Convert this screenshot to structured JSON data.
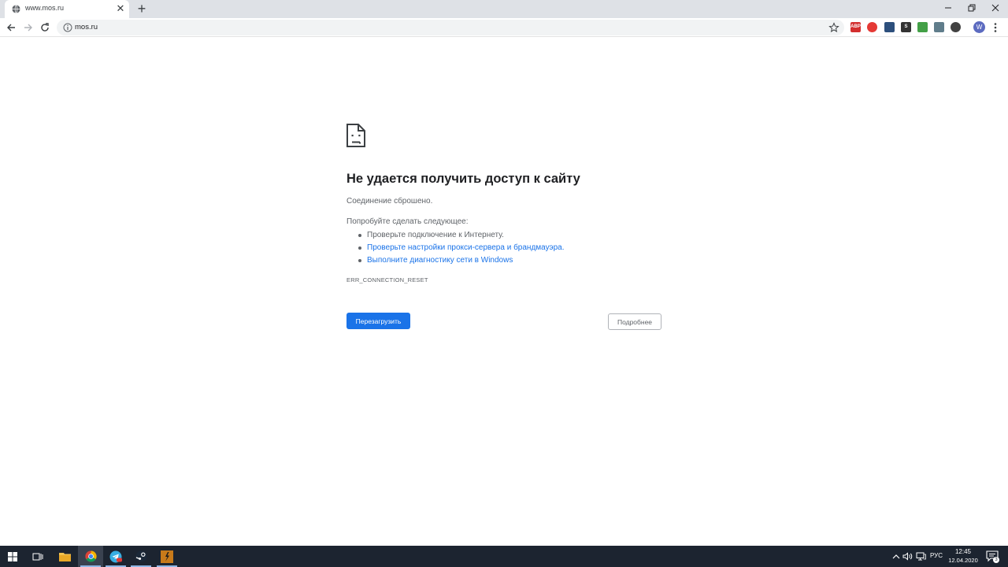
{
  "tab": {
    "title": "www.mos.ru",
    "close_glyph": "✕",
    "favicon": "globe-icon"
  },
  "new_tab_glyph": "+",
  "window_controls": [
    "minimize-icon",
    "restore-icon",
    "close-icon"
  ],
  "toolbar": {
    "url": "mos.ru",
    "extensions": [
      {
        "name": "abp-icon",
        "label": "ABP",
        "color": "#d32f2f"
      },
      {
        "name": "opera-red-icon",
        "label": "",
        "color": "#e53935"
      },
      {
        "name": "extension-mail-icon",
        "label": "",
        "color": "#2d4f7c"
      },
      {
        "name": "extension-s-icon",
        "label": "S",
        "color": "#333333"
      },
      {
        "name": "extension-green-icon",
        "label": "",
        "color": "#43a047"
      },
      {
        "name": "extension-photo-icon",
        "label": "",
        "color": "#607d8b"
      },
      {
        "name": "extension-shield-icon",
        "label": "",
        "color": "#424242"
      }
    ],
    "profile_initial": "W"
  },
  "error": {
    "title": "Не удается получить доступ к сайту",
    "subtitle": "Соединение сброшено.",
    "try_label": "Попробуйте сделать следующее:",
    "suggestions": {
      "check_connection": "Проверьте подключение к Интернету.",
      "check_proxy": "Проверьте настройки прокси-сервера и брандмауэра.",
      "run_diagnostics": "Выполните диагностику сети в Windows"
    },
    "code": "ERR_CONNECTION_RESET",
    "reload_label": "Перезагрузить",
    "details_label": "Подробнее"
  },
  "taskbar": {
    "apps": [
      "start-icon",
      "task-view-icon",
      "file-explorer-icon",
      "chrome-icon",
      "telegram-icon",
      "steam-icon",
      "game-icon"
    ],
    "language": "РУС",
    "time": "12:45",
    "date": "12.04.2020",
    "notification_count": "3"
  },
  "colors": {
    "accent": "#1a73e8",
    "taskbar": "#1c2430"
  }
}
